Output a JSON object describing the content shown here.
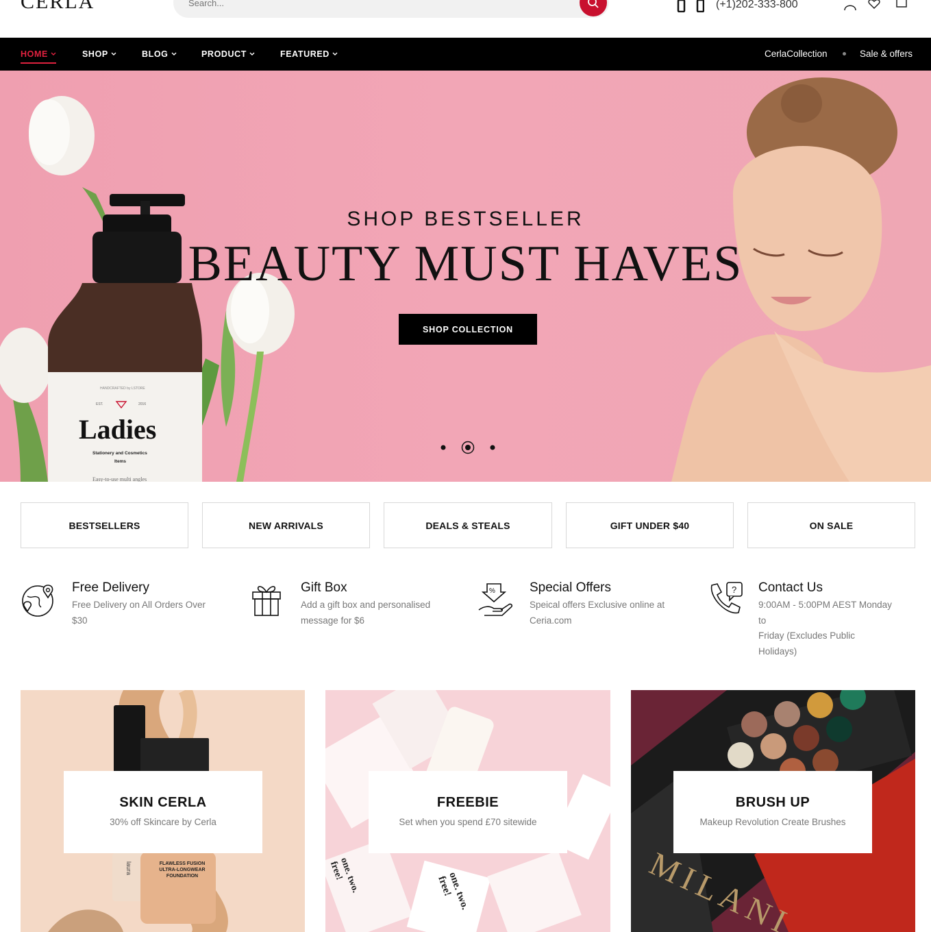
{
  "header": {
    "logo": "CERLA",
    "search_placeholder": "Search...",
    "phone": "(+1)202-333-800"
  },
  "nav": {
    "items": [
      {
        "label": "HOME",
        "active": true
      },
      {
        "label": "SHOP"
      },
      {
        "label": "BLOG"
      },
      {
        "label": "PRODUCT"
      },
      {
        "label": "FEATURED"
      }
    ],
    "right": [
      "CerlaCollection",
      "Sale & offers"
    ]
  },
  "hero": {
    "pretitle": "SHOP BESTSELLER",
    "title": "BEAUTY MUST HAVES",
    "button": "SHOP COLLECTION",
    "bottle_brand": "Ladies",
    "bottle_small": "HANDCRAFTED by LSTORE",
    "bottle_est": "EST.",
    "bottle_year": "2016",
    "bottle_line1": "Stationery and Cosmetics",
    "bottle_line2": "Items",
    "bottle_bottom": "Easy-to-use multi angles",
    "slides": 3,
    "active_slide": 2
  },
  "categories": [
    "BESTSELLERS",
    "NEW ARRIVALS",
    "DEALS & STEALS",
    "GIFT UNDER $40",
    "ON SALE"
  ],
  "features": [
    {
      "icon": "globe-location-icon",
      "title": "Free Delivery",
      "desc": "Free Delivery on All Orders Over $30"
    },
    {
      "icon": "gift-box-icon",
      "title": "Gift Box",
      "desc": "Add a gift box and personalised message for $6"
    },
    {
      "icon": "discount-hand-icon",
      "title": "Special Offers",
      "desc": "Speical offers Exclusive online at Ceria.com"
    },
    {
      "icon": "phone-question-icon",
      "title": "Contact Us",
      "desc_lines": [
        "9:00AM - 5:00PM AEST Monday",
        "to",
        "Friday (Excludes Public",
        "Holidays)"
      ]
    }
  ],
  "promos": [
    {
      "title": "SKIN CERLA",
      "sub": "30% off Skincare by Cerla",
      "label1": "FLAWLESS FUSION",
      "label2": "ULTRA-LONGWEAR",
      "label3": "FOUNDATION",
      "brand": "laura"
    },
    {
      "title": "FREEBIE",
      "sub": "Set when you spend £70 sitewide",
      "pack": "one. two. free!"
    },
    {
      "title": "BRUSH UP",
      "sub": "Makeup Revolution Create Brushes",
      "brand": "MILANI"
    }
  ],
  "colors": {
    "accent": "#c8102e",
    "nav_bg": "#000000",
    "hero_bg": "#f2a6b6"
  }
}
